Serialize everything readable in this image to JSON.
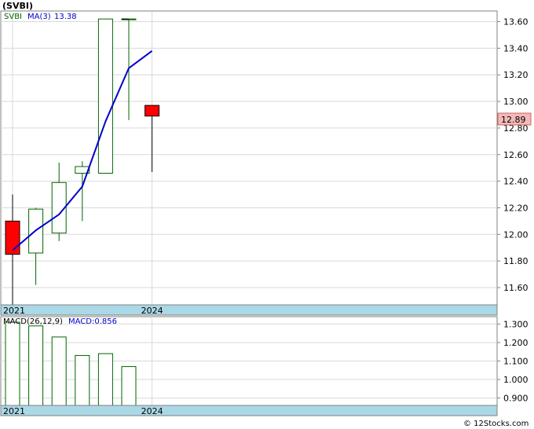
{
  "chart_data": [
    {
      "type": "candlestick",
      "title": "(SVBI)",
      "symbol_label": "SVBI",
      "ma_label": "MA(3)",
      "ma_value": "13.38",
      "last_price": "12.89",
      "categories": [
        "2021",
        "2021.5",
        "2022",
        "2022.5",
        "2023",
        "2023.5",
        "2024"
      ],
      "x_tick_labels": [
        "2021",
        "2024"
      ],
      "candles": [
        {
          "open": 12.1,
          "close": 11.85,
          "high": 12.3,
          "low": 11.45
        },
        {
          "open": 11.86,
          "close": 12.19,
          "high": 12.2,
          "low": 11.62
        },
        {
          "open": 12.01,
          "close": 12.39,
          "high": 12.54,
          "low": 11.95
        },
        {
          "open": 12.46,
          "close": 12.51,
          "high": 12.55,
          "low": 12.1
        },
        {
          "open": 12.46,
          "close": 13.62,
          "high": 13.62,
          "low": 12.46
        },
        {
          "open": 13.62,
          "close": 13.62,
          "high": 13.62,
          "low": 12.86
        },
        {
          "open": 12.97,
          "close": 12.89,
          "high": 12.97,
          "low": 12.47
        }
      ],
      "ma_series": {
        "name": "MA(3)",
        "values": [
          11.88,
          12.03,
          12.15,
          12.36,
          12.85,
          13.25,
          13.38
        ]
      },
      "y_ticks": [
        "11.60",
        "11.80",
        "12.00",
        "12.20",
        "12.40",
        "12.60",
        "12.80",
        "13.00",
        "13.20",
        "13.40",
        "13.60"
      ],
      "ylim": [
        11.47,
        13.68
      ],
      "colors": {
        "up": "#006400",
        "down": "#ff0000",
        "ma": "#0000cc",
        "axis_band": "#aad8e6"
      }
    },
    {
      "type": "bar",
      "title": "MACD(26,12,9)",
      "macd_label": "MACD:0.856",
      "categories": [
        "2021",
        "2021.5",
        "2022",
        "2022.5",
        "2023",
        "2023.5"
      ],
      "x_tick_labels": [
        "2021",
        "2024"
      ],
      "values": [
        1.31,
        1.29,
        1.23,
        1.13,
        1.14,
        1.07
      ],
      "y_ticks": [
        "0.900",
        "1.000",
        "1.100",
        "1.200",
        "1.300"
      ],
      "ylim": [
        0.86,
        1.34
      ]
    }
  ],
  "watermark": "© 12Stocks.com"
}
